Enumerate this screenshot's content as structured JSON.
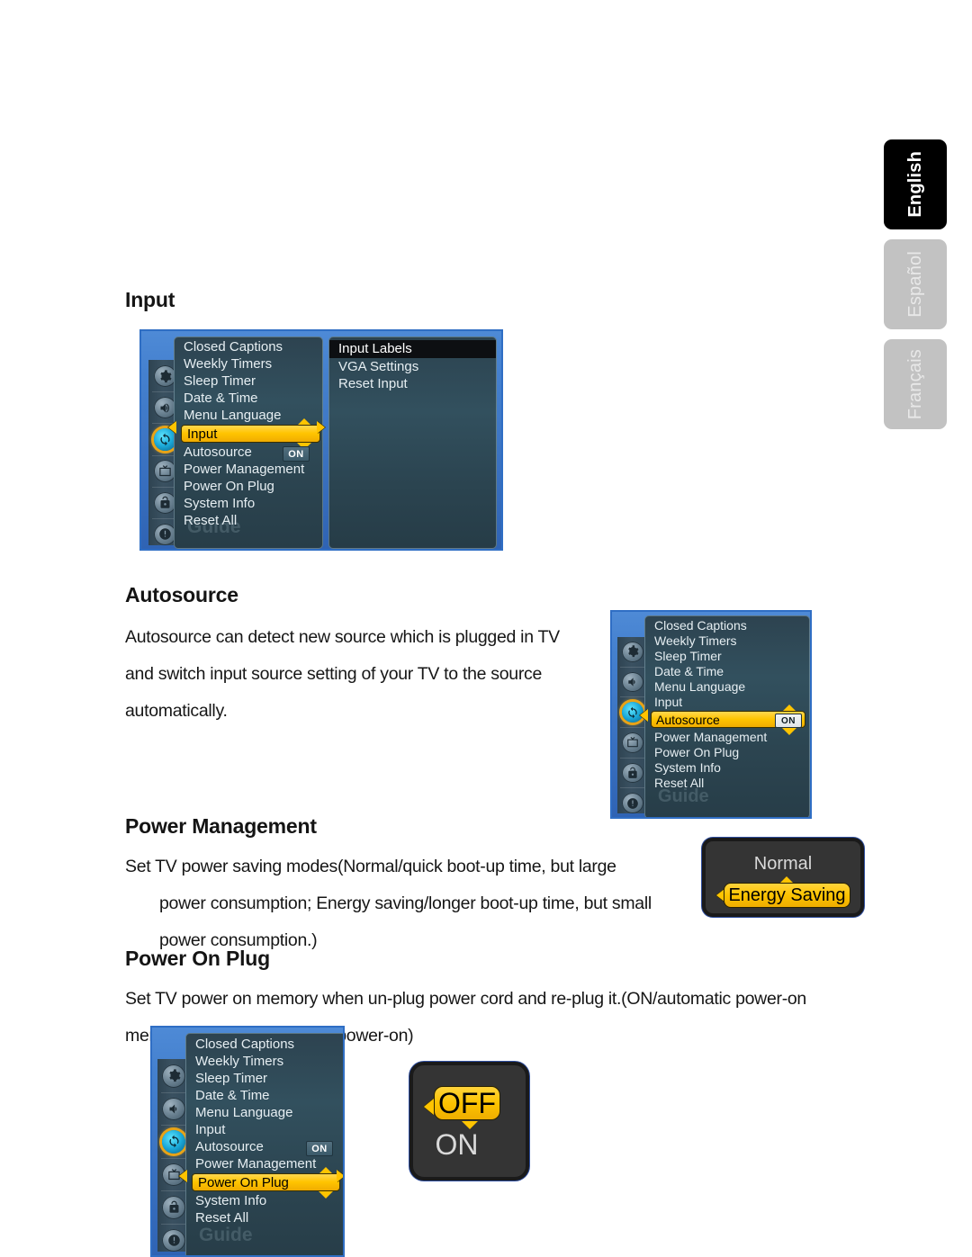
{
  "language_tabs": [
    {
      "label": "English",
      "active": true
    },
    {
      "label": "Español",
      "active": false
    },
    {
      "label": "Français",
      "active": false
    }
  ],
  "sections": {
    "input": {
      "heading": "Input",
      "menu": {
        "items": [
          "Closed Captions",
          "Weekly Timers",
          "Sleep Timer",
          "Date & Time",
          "Menu Language",
          "Input",
          "Autosource",
          "Power Management",
          "Power On Plug",
          "System Info",
          "Reset All"
        ],
        "highlighted": "Input",
        "autosource_value": "ON",
        "watermark": "Guide",
        "rail_icons": [
          "gear-icon",
          "speaker-icon",
          "setup-refresh-icon",
          "tv-icon",
          "lock-icon",
          "info-icon"
        ],
        "rail_selected_index": 2
      },
      "submenu": {
        "items": [
          "Input Labels",
          "VGA Settings",
          "Reset Input"
        ],
        "selected": "Input Labels"
      }
    },
    "autosource": {
      "heading": "Autosource",
      "body_lines": [
        "Autosource can detect new source which is plugged in TV",
        "and switch input source setting of your TV to the source",
        "automatically."
      ],
      "menu": {
        "items": [
          "Closed Captions",
          "Weekly Timers",
          "Sleep Timer",
          "Date & Time",
          "Menu Language",
          "Input",
          "Autosource",
          "Power Management",
          "Power On Plug",
          "System Info",
          "Reset All"
        ],
        "highlighted": "Autosource",
        "autosource_value": "ON",
        "watermark": "Guide"
      }
    },
    "power_management": {
      "heading": "Power Management",
      "body_lines": [
        "Set TV power saving modes(Normal/quick boot-up time, but large",
        "power consumption; Energy saving/longer boot-up time, but small",
        "power consumption.)"
      ],
      "value_box": {
        "options": [
          "Normal",
          "Energy Saving"
        ],
        "selected": "Energy Saving"
      }
    },
    "power_on_plug": {
      "heading": "Power On Plug",
      "body_lines": [
        "Set TV power on memory when un-plug power cord and re-plug it.(ON/automatic power-on",
        "memory; OFF/no automatic power-on)"
      ],
      "menu": {
        "items": [
          "Closed Captions",
          "Weekly Timers",
          "Sleep Timer",
          "Date & Time",
          "Menu Language",
          "Input",
          "Autosource",
          "Power Management",
          "Power On Plug",
          "System Info",
          "Reset All"
        ],
        "highlighted": "Power On Plug",
        "autosource_value": "ON",
        "watermark": "Guide"
      },
      "value_box": {
        "options": [
          "OFF",
          "ON"
        ],
        "selected": "OFF"
      }
    }
  },
  "colors": {
    "highlight_yellow": "#ffc400",
    "osd_border_blue": "#2f6ec4",
    "panel_dark": "#2d4350",
    "tab_active": "#000000",
    "tab_inactive": "#c2c2c2"
  }
}
